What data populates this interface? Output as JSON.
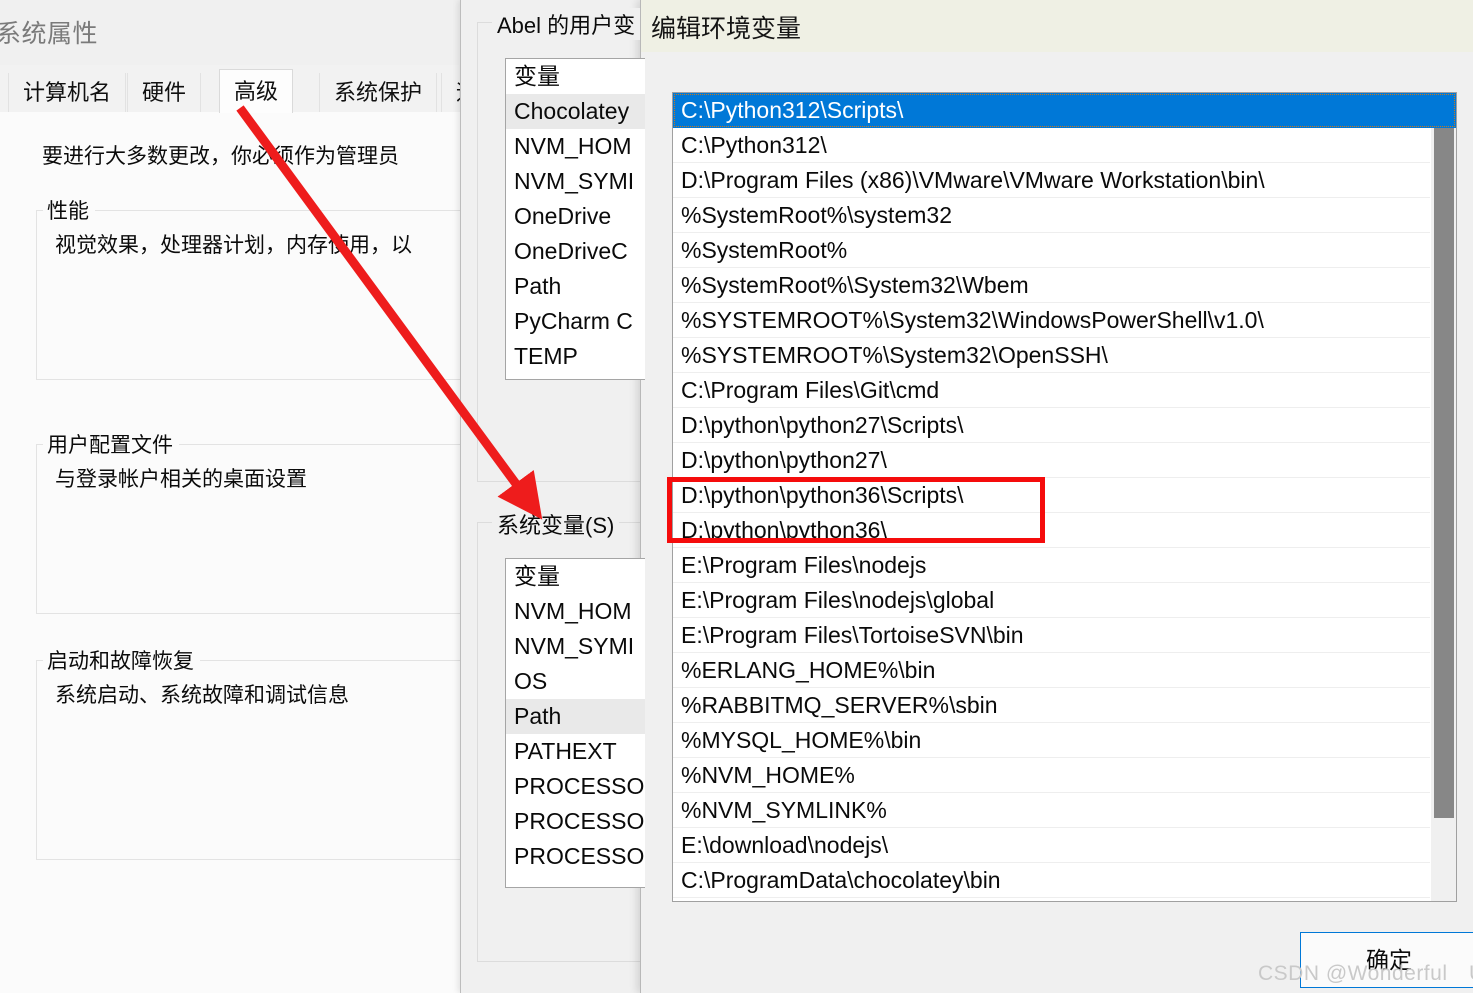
{
  "system_properties": {
    "window_title": "系统属性",
    "tabs": [
      {
        "label": "计算机名",
        "active": false
      },
      {
        "label": "硬件",
        "active": false
      },
      {
        "label": "高级",
        "active": true
      },
      {
        "label": "系统保护",
        "active": false
      },
      {
        "label": "远",
        "active": false
      }
    ],
    "intro_text": "要进行大多数更改，你必须作为管理员",
    "groups": [
      {
        "label": "性能",
        "text": "视觉效果，处理器计划，内存使用，以"
      },
      {
        "label": "用户配置文件",
        "text": "与登录帐户相关的桌面设置"
      },
      {
        "label": "启动和故障恢复",
        "text": "系统启动、系统故障和调试信息"
      }
    ]
  },
  "environment_variables": {
    "user_group_label": "Abel 的用户变",
    "system_group_label": "系统变量(S)",
    "user_list": {
      "header": "变量",
      "items": [
        {
          "name": "Chocolatey",
          "selected": true
        },
        {
          "name": "NVM_HOM",
          "selected": false
        },
        {
          "name": "NVM_SYMI",
          "selected": false
        },
        {
          "name": "OneDrive",
          "selected": false
        },
        {
          "name": "OneDriveC",
          "selected": false
        },
        {
          "name": "Path",
          "selected": false
        },
        {
          "name": "PyCharm C",
          "selected": false
        },
        {
          "name": "TEMP",
          "selected": false
        }
      ]
    },
    "system_list": {
      "header": "变量",
      "items": [
        {
          "name": "NVM_HOM",
          "selected": false
        },
        {
          "name": "NVM_SYMI",
          "selected": false
        },
        {
          "name": "OS",
          "selected": false
        },
        {
          "name": "Path",
          "selected": true
        },
        {
          "name": "PATHEXT",
          "selected": false
        },
        {
          "name": "PROCESSO",
          "selected": false
        },
        {
          "name": "PROCESSO",
          "selected": false
        },
        {
          "name": "PROCESSO",
          "selected": false
        }
      ]
    }
  },
  "edit_environment_variable": {
    "window_title": "编辑环境变量",
    "ok_button_label": "确定",
    "paths": [
      {
        "value": "C:\\Python312\\Scripts\\",
        "selected": true,
        "highlighted": false
      },
      {
        "value": "C:\\Python312\\",
        "selected": false,
        "highlighted": false
      },
      {
        "value": "D:\\Program Files (x86)\\VMware\\VMware Workstation\\bin\\",
        "selected": false,
        "highlighted": false
      },
      {
        "value": "%SystemRoot%\\system32",
        "selected": false,
        "highlighted": false
      },
      {
        "value": "%SystemRoot%",
        "selected": false,
        "highlighted": false
      },
      {
        "value": "%SystemRoot%\\System32\\Wbem",
        "selected": false,
        "highlighted": false
      },
      {
        "value": "%SYSTEMROOT%\\System32\\WindowsPowerShell\\v1.0\\",
        "selected": false,
        "highlighted": false
      },
      {
        "value": "%SYSTEMROOT%\\System32\\OpenSSH\\",
        "selected": false,
        "highlighted": false
      },
      {
        "value": "C:\\Program Files\\Git\\cmd",
        "selected": false,
        "highlighted": false
      },
      {
        "value": "D:\\python\\python27\\Scripts\\",
        "selected": false,
        "highlighted": false
      },
      {
        "value": "D:\\python\\python27\\",
        "selected": false,
        "highlighted": false
      },
      {
        "value": "D:\\python\\python36\\Scripts\\",
        "selected": false,
        "highlighted": true
      },
      {
        "value": "D:\\python\\python36\\",
        "selected": false,
        "highlighted": true
      },
      {
        "value": "E:\\Program Files\\nodejs",
        "selected": false,
        "highlighted": false
      },
      {
        "value": "E:\\Program Files\\nodejs\\global",
        "selected": false,
        "highlighted": false
      },
      {
        "value": "E:\\Program Files\\TortoiseSVN\\bin",
        "selected": false,
        "highlighted": false
      },
      {
        "value": "%ERLANG_HOME%\\bin",
        "selected": false,
        "highlighted": false
      },
      {
        "value": "%RABBITMQ_SERVER%\\sbin",
        "selected": false,
        "highlighted": false
      },
      {
        "value": "%MYSQL_HOME%\\bin",
        "selected": false,
        "highlighted": false
      },
      {
        "value": "%NVM_HOME%",
        "selected": false,
        "highlighted": false
      },
      {
        "value": "%NVM_SYMLINK%",
        "selected": false,
        "highlighted": false
      },
      {
        "value": "E:\\download\\nodejs\\",
        "selected": false,
        "highlighted": false
      },
      {
        "value": "C:\\ProgramData\\chocolatey\\bin",
        "selected": false,
        "highlighted": false
      }
    ]
  },
  "annotations": {
    "arrow_color": "#ee1c1c",
    "highlight_box_color": "#f50c0c",
    "watermark": "CSDN @Wonderful　U"
  }
}
